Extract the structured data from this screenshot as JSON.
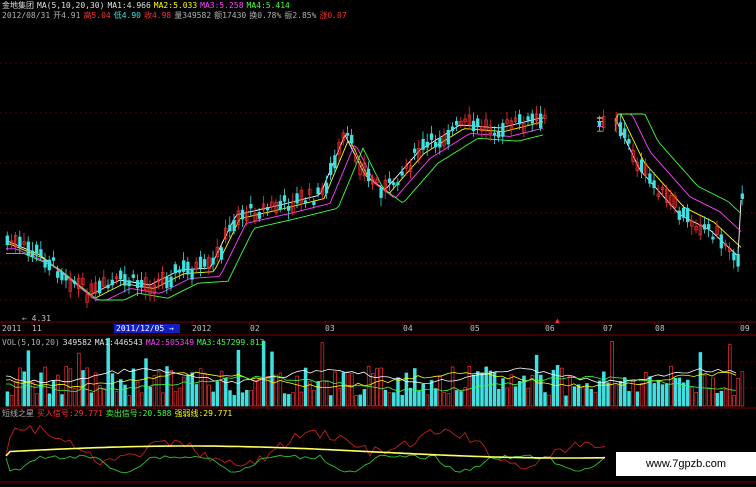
{
  "header": {
    "stock_name": "金地集团",
    "ma_params": "MA(5,10,20,30)",
    "ma1_label": "MA1:",
    "ma1_value": "4.966",
    "ma2_label": "MA2:",
    "ma2_value": "5.033",
    "ma3_label": "MA3:",
    "ma3_value": "5.258",
    "ma4_label": "MA4:",
    "ma4_value": "5.414"
  },
  "quote": {
    "date": "2012/08/31",
    "open": "开4.91",
    "high": "高5.04",
    "low": "低4.90",
    "close": "收4.98",
    "volume": "量349582",
    "amount": "额17430",
    "turnover": "换0.78%",
    "amplitude": "振2.85%",
    "change": "涨0.07"
  },
  "price_chart": {
    "low_marker": "4.31",
    "axis_labels": [
      "2011",
      "11",
      "2012",
      "02",
      "03",
      "04",
      "05",
      "06",
      "07",
      "08",
      "09"
    ],
    "cursor_date": "2011/12/05"
  },
  "volume_panel": {
    "title": "VOL(5,10,20)",
    "value": "349582",
    "ma1": "MA1:446543",
    "ma2": "MA2:505349",
    "ma3": "MA3:457299.813"
  },
  "indicator_panel": {
    "title": "短线之星",
    "buy_label": "买入信号:",
    "buy_value": "29.771",
    "sell_label": "卖出信号:",
    "sell_value": "20.588",
    "strength_label": "强弱线:",
    "strength_value": "29.771"
  },
  "watermark": "www.7gpzb.com",
  "colors": {
    "up": "#ff3030",
    "down": "#40e0e0",
    "ma1": "#ffffff",
    "ma2": "#ffff00",
    "ma3": "#ff40ff",
    "ma4": "#40ff40",
    "grid": "#a00000"
  }
}
